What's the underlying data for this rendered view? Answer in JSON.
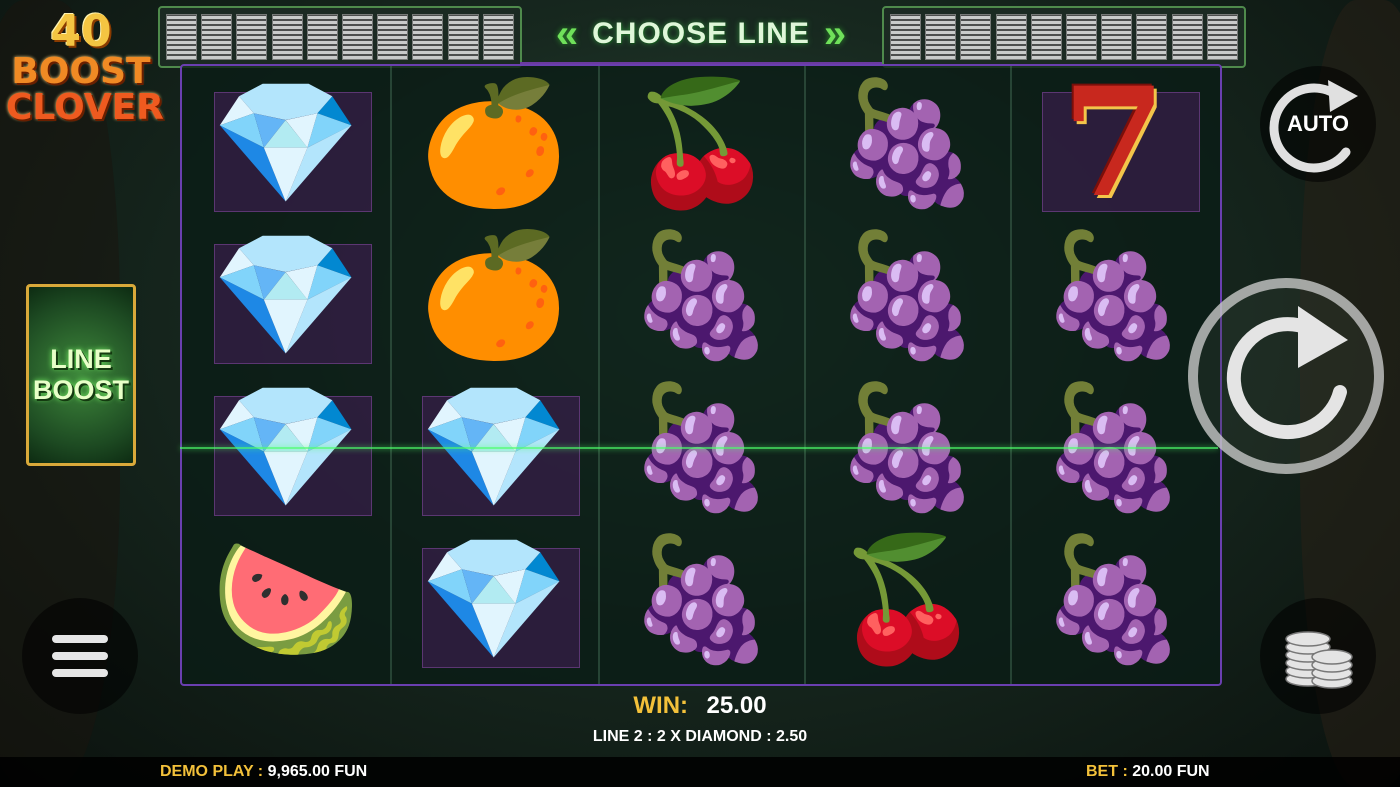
{
  "logo": {
    "line1": "40",
    "line2": "BOOST",
    "line3": "CLOVER"
  },
  "header": {
    "choose_line_label": "CHOOSE LINE",
    "left_chevron": "«",
    "right_chevron": "»"
  },
  "line_booster": {
    "line1": "LINE",
    "line2": "BOOST"
  },
  "controls": {
    "auto_label": "AUTO"
  },
  "reels": [
    [
      "diamond",
      "diamond",
      "diamond",
      "watermelon"
    ],
    [
      "orange",
      "orange",
      "diamond",
      "diamond"
    ],
    [
      "cherry",
      "grapes",
      "grapes",
      "grapes"
    ],
    [
      "grapes",
      "grapes",
      "grapes",
      "cherry"
    ],
    [
      "seven",
      "grapes",
      "grapes",
      "grapes"
    ]
  ],
  "symbols": {
    "diamond": "💎",
    "orange": "🍊",
    "cherry": "🍒",
    "grapes": "🍇",
    "watermelon": "🍉",
    "seven": "7"
  },
  "win": {
    "label": "WIN:",
    "value": "25.00",
    "detail": "LINE 2 : 2 X DIAMOND : 2.50"
  },
  "footer": {
    "demo_label": "DEMO PLAY :",
    "demo_value": "9,965.00 FUN",
    "bet_label": "BET :",
    "bet_value": "20.00 FUN"
  },
  "colors": {
    "accent_gold": "#f3c13a",
    "reel_border": "#6a3fb0",
    "win_line": "#4dff6a"
  }
}
